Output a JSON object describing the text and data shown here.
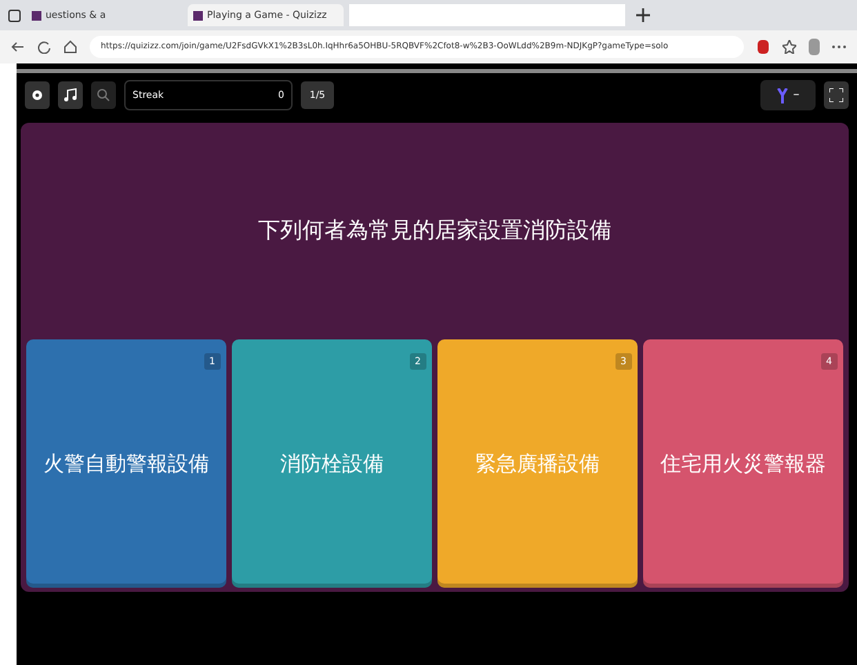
{
  "browser": {
    "tabs": [
      {
        "title": "uestions & a",
        "selected": false
      },
      {
        "title": "Playing a Game - Quizizz",
        "selected": true
      }
    ],
    "url": "https://quizizz.com/join/game/U2FsdGVkX1%2B3sL0h.IqHhr6a5OHBU-5RQBVF%2Cfot8-w%2B3-OoWLdd%2B9m-NDJKgP?gameType=solo"
  },
  "toolbar": {
    "streak_label": "Streak",
    "streak_value": "0",
    "progress": "1/5",
    "score": "–"
  },
  "question": "下列何者為常見的居家設置消防設備",
  "answers": [
    {
      "number": "1",
      "text": "火警自動警報設備",
      "color": "#2d70ae"
    },
    {
      "number": "2",
      "text": "消防栓設備",
      "color": "#2d9da6"
    },
    {
      "number": "3",
      "text": "緊急廣播設備",
      "color": "#efa929"
    },
    {
      "number": "4",
      "text": "住宅用火災警報器",
      "color": "#d5546d"
    }
  ]
}
